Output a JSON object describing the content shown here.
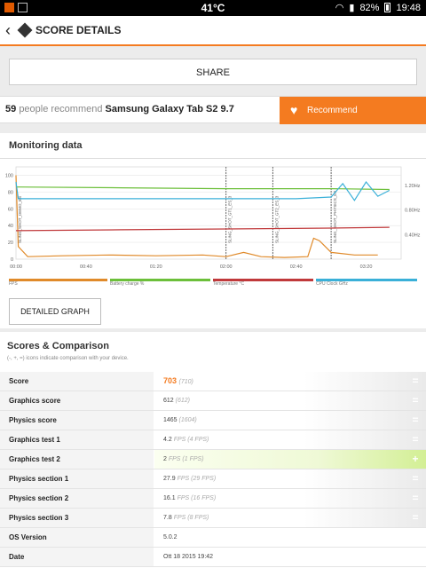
{
  "status_bar": {
    "temperature": "41°C",
    "battery": "82%",
    "time": "19:48"
  },
  "header": {
    "title": "SCORE DETAILS"
  },
  "share": {
    "label": "SHARE"
  },
  "recommend": {
    "count": "59",
    "text": "people recommend",
    "device": "Samsung Galaxy Tab S2 9.7",
    "button_label": "Recommend"
  },
  "monitoring": {
    "title": "Monitoring data",
    "detailed_graph_label": "DETAILED GRAPH",
    "legend": [
      "FPS",
      "Battery charge %",
      "Temperature °C",
      "CPU Clock GHz"
    ]
  },
  "chart_data": {
    "type": "line",
    "x_ticks": [
      "00:00",
      "00:40",
      "01:20",
      "02:00",
      "02:40",
      "03:20"
    ],
    "y_ticks_left": [
      100,
      80,
      60,
      40,
      20,
      0
    ],
    "y_ticks_right": [
      "1.20Hz",
      "0.80Hz",
      "0.40Hz"
    ],
    "phase_labels": [
      "SLING_SHOT_DEMO_ES",
      "SLING_SHOT_GT1_ES_3",
      "SLING_SHOT_GT2_ES_3",
      "SLING_SHOT_PHYSICS_ES"
    ],
    "phase_times_s": [
      0,
      180,
      220,
      270
    ],
    "series": [
      {
        "name": "FPS",
        "color": "#e08a2a",
        "points": [
          [
            0,
            100
          ],
          [
            2,
            15
          ],
          [
            10,
            3
          ],
          [
            40,
            4
          ],
          [
            80,
            5
          ],
          [
            120,
            4
          ],
          [
            160,
            5
          ],
          [
            180,
            3
          ],
          [
            195,
            8
          ],
          [
            210,
            3
          ],
          [
            230,
            2
          ],
          [
            250,
            3
          ],
          [
            255,
            25
          ],
          [
            260,
            22
          ],
          [
            265,
            15
          ],
          [
            270,
            8
          ],
          [
            290,
            5
          ],
          [
            310,
            5
          ]
        ]
      },
      {
        "name": "Battery charge %",
        "color": "#6cbf3a",
        "points": [
          [
            0,
            86
          ],
          [
            90,
            85
          ],
          [
            180,
            84
          ],
          [
            270,
            84
          ],
          [
            320,
            83
          ]
        ]
      },
      {
        "name": "Temperature °C",
        "color": "#c0393b",
        "points": [
          [
            0,
            34
          ],
          [
            90,
            35
          ],
          [
            180,
            36
          ],
          [
            270,
            37
          ],
          [
            320,
            38
          ]
        ]
      },
      {
        "name": "CPU Clock GHz",
        "color": "#3ab0d8",
        "points": [
          [
            0,
            92
          ],
          [
            2,
            72
          ],
          [
            30,
            72
          ],
          [
            60,
            72
          ],
          [
            90,
            72
          ],
          [
            120,
            72
          ],
          [
            150,
            72
          ],
          [
            180,
            72
          ],
          [
            210,
            72
          ],
          [
            240,
            72
          ],
          [
            270,
            74
          ],
          [
            280,
            90
          ],
          [
            290,
            70
          ],
          [
            300,
            92
          ],
          [
            310,
            75
          ],
          [
            320,
            82
          ]
        ]
      }
    ]
  },
  "scores": {
    "title": "Scores & Comparison",
    "subtitle": "(-, +, =) icons indicate comparison with your device.",
    "rows": [
      {
        "label": "Score",
        "value": "703",
        "compare": "(710)",
        "mark": "="
      },
      {
        "label": "Graphics score",
        "value": "612",
        "compare": "(612)",
        "mark": "="
      },
      {
        "label": "Physics score",
        "value": "1465",
        "compare": "(1604)",
        "mark": "="
      },
      {
        "label": "Graphics test 1",
        "value": "4.2",
        "compare": "FPS (4 FPS)",
        "mark": "="
      },
      {
        "label": "Graphics test 2",
        "value": "2",
        "compare": "FPS (1 FPS)",
        "mark": "+"
      },
      {
        "label": "Physics section 1",
        "value": "27.9",
        "compare": "FPS (29 FPS)",
        "mark": "="
      },
      {
        "label": "Physics section 2",
        "value": "16.1",
        "compare": "FPS (16 FPS)",
        "mark": "="
      },
      {
        "label": "Physics section 3",
        "value": "7.8",
        "compare": "FPS (8 FPS)",
        "mark": "="
      },
      {
        "label": "OS Version",
        "value": "5.0.2",
        "compare": "",
        "mark": ""
      },
      {
        "label": "Date",
        "value": "Ott 18 2015 19:42",
        "compare": "",
        "mark": ""
      }
    ]
  }
}
